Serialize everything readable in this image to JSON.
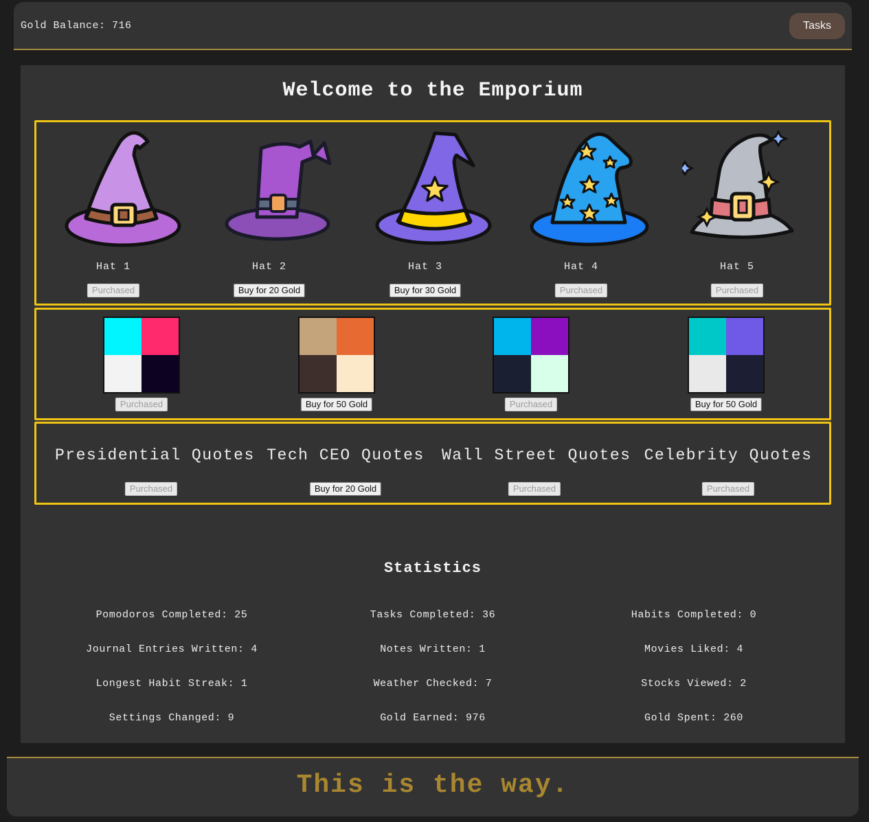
{
  "header": {
    "gold_balance": "Gold Balance: 716",
    "tasks_label": "Tasks"
  },
  "title": "Welcome to the Emporium",
  "hats": [
    {
      "label": "Hat 1",
      "button": "Purchased",
      "purchased": true,
      "icon": "witch-hat-purple-icon"
    },
    {
      "label": "Hat 2",
      "button": "Buy for 20 Gold",
      "purchased": false,
      "icon": "witch-hat-violet-icon"
    },
    {
      "label": "Hat 3",
      "button": "Buy for 30 Gold",
      "purchased": false,
      "icon": "wizard-hat-star-icon"
    },
    {
      "label": "Hat 4",
      "button": "Purchased",
      "purchased": true,
      "icon": "wizard-hat-blue-stars-icon"
    },
    {
      "label": "Hat 5",
      "button": "Purchased",
      "purchased": true,
      "icon": "witch-hat-grey-sparkle-icon"
    }
  ],
  "themes": [
    {
      "button": "Purchased",
      "purchased": true,
      "colors": [
        "#00f5ff",
        "#ff2a6d",
        "#f3f3f3",
        "#0d0221"
      ]
    },
    {
      "button": "Buy for 50 Gold",
      "purchased": false,
      "colors": [
        "#c4a57b",
        "#e86a33",
        "#3e2e2c",
        "#fce9ca"
      ]
    },
    {
      "button": "Purchased",
      "purchased": true,
      "colors": [
        "#00b4ec",
        "#8c0fbf",
        "#1b1f32",
        "#d7ffe9"
      ]
    },
    {
      "button": "Buy for 50 Gold",
      "purchased": false,
      "colors": [
        "#00c8c8",
        "#6f5ae8",
        "#e9e9e9",
        "#1c1f33"
      ]
    }
  ],
  "quotes": [
    {
      "label": "Presidential Quotes",
      "button": "Purchased",
      "purchased": true
    },
    {
      "label": "Tech CEO Quotes",
      "button": "Buy for 20 Gold",
      "purchased": false
    },
    {
      "label": "Wall Street Quotes",
      "button": "Purchased",
      "purchased": true
    },
    {
      "label": "Celebrity Quotes",
      "button": "Purchased",
      "purchased": true
    }
  ],
  "statistics": {
    "title": "Statistics",
    "items": [
      "Pomodoros Completed: 25",
      "Tasks Completed: 36",
      "Habits Completed: 0",
      "Journal Entries Written: 4",
      "Notes Written: 1",
      "Movies Liked: 4",
      "Longest Habit Streak: 1",
      "Weather Checked: 7",
      "Stocks Viewed: 2",
      "Settings Changed: 9",
      "Gold Earned: 976",
      "Gold Spent: 260"
    ]
  },
  "footer": {
    "text": "This is the way."
  }
}
